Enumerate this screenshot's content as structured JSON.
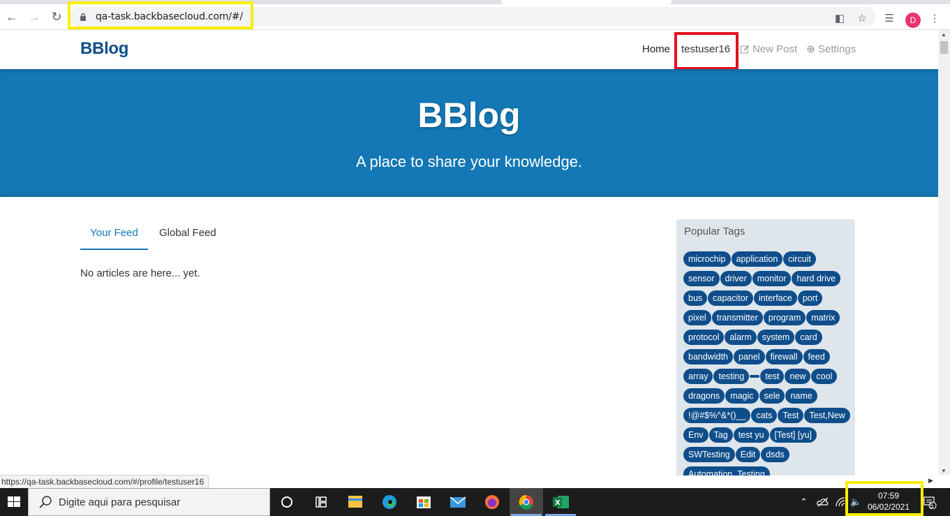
{
  "browser": {
    "url": "qa-task.backbasecloud.com/#/",
    "avatar_letter": "D",
    "status_url": "https://qa-task.backbasecloud.com/#/profile/testuser16"
  },
  "navbar": {
    "brand": "BBlog",
    "home": "Home",
    "user": "testuser16",
    "new_post": "New Post",
    "settings": "Settings"
  },
  "banner": {
    "title": "BBlog",
    "subtitle": "A place to share your knowledge."
  },
  "feed": {
    "tabs": [
      "Your Feed",
      "Global Feed"
    ],
    "empty_message": "No articles are here... yet."
  },
  "sidebar": {
    "title": "Popular Tags",
    "tags": [
      "microchip",
      "application",
      "circuit",
      "sensor",
      "driver",
      "monitor",
      "hard drive",
      "bus",
      "capacitor",
      "interface",
      "port",
      "pixel",
      "transmitter",
      "program",
      "matrix",
      "protocol",
      "alarm",
      "system",
      "card",
      "bandwidth",
      "panel",
      "firewall",
      "feed",
      "array",
      "testing",
      "",
      "test",
      "new",
      "cool",
      "dragons",
      "magic",
      "sele",
      "name",
      "!@#$%^&*()__",
      "cats",
      "Test",
      "Test,New",
      "Env",
      "Tag",
      "test yu",
      "[Test] [yu]",
      "SWTesting",
      "Edit",
      "dsds",
      "Automation_Testing"
    ]
  },
  "taskbar": {
    "search_placeholder": "Digite aqui para pesquisar",
    "time": "07:59",
    "date": "06/02/2021",
    "notification_count": "5"
  },
  "colors": {
    "brand": "#0f4e8a",
    "banner": "#1378b5",
    "tag_bg": "#0f4e8a",
    "highlight_yellow": "#f8f000",
    "highlight_red": "#e3101c"
  }
}
